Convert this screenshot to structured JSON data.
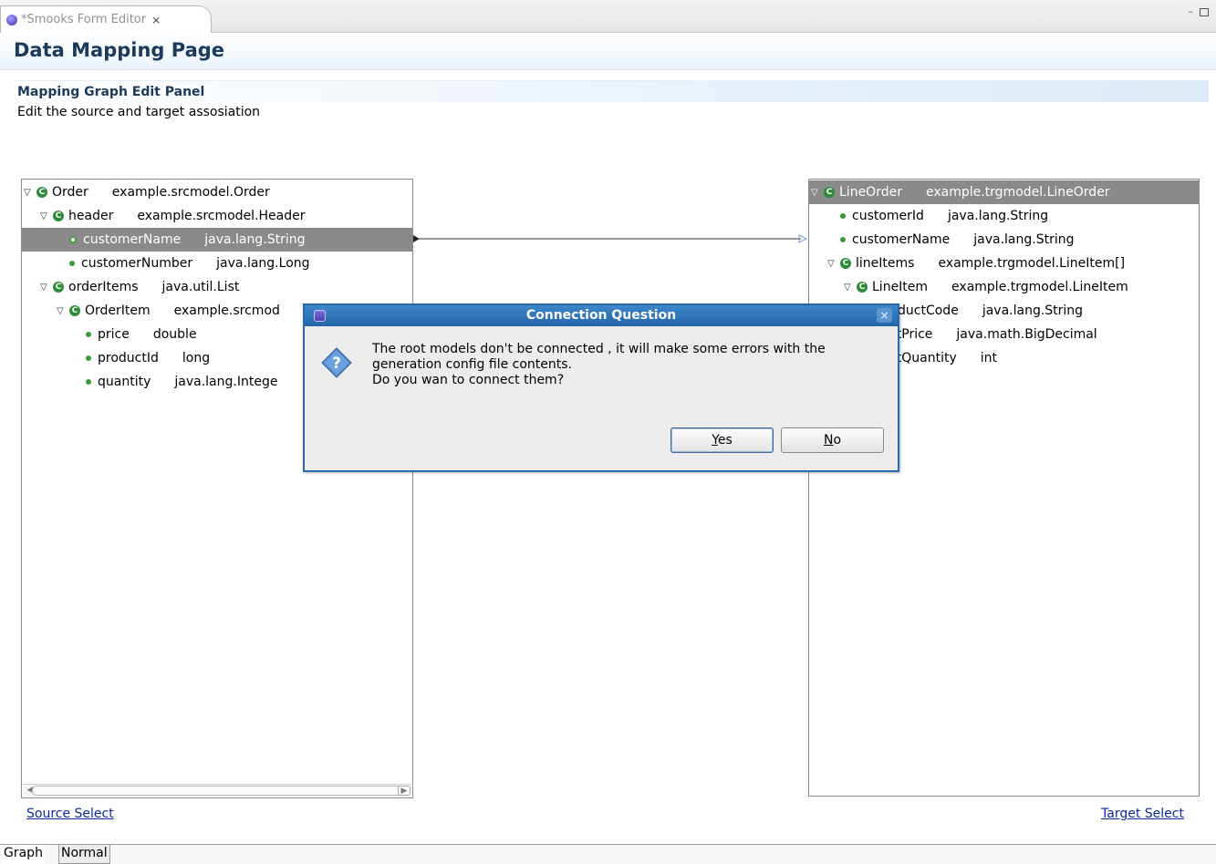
{
  "editor_tab": {
    "title": "*Smooks Form Editor",
    "close_glyph": "⨯"
  },
  "window_controls": {
    "minimize_glyph": "–"
  },
  "header": {
    "title": "Data Mapping Page"
  },
  "section": {
    "title": "Mapping Graph Edit Panel",
    "description": "Edit the source and target assosiation"
  },
  "source_tree": {
    "rows": [
      {
        "depth": 0,
        "kind": "class",
        "expanded": true,
        "name": "Order",
        "type": "example.srcmodel.Order"
      },
      {
        "depth": 1,
        "kind": "class",
        "expanded": true,
        "name": "header",
        "type": "example.srcmodel.Header"
      },
      {
        "depth": 2,
        "kind": "field",
        "name": "customerName",
        "type": "java.lang.String",
        "selected": true
      },
      {
        "depth": 2,
        "kind": "field",
        "name": "customerNumber",
        "type": "java.lang.Long"
      },
      {
        "depth": 1,
        "kind": "class",
        "expanded": true,
        "name": "orderItems",
        "type": "java.util.List"
      },
      {
        "depth": 2,
        "kind": "class",
        "expanded": true,
        "name": "OrderItem",
        "type": "example.srcmod"
      },
      {
        "depth": 3,
        "kind": "field",
        "name": "price",
        "type": "double"
      },
      {
        "depth": 3,
        "kind": "field",
        "name": "productId",
        "type": "long"
      },
      {
        "depth": 3,
        "kind": "field",
        "name": "quantity",
        "type": "java.lang.Intege"
      }
    ]
  },
  "target_tree": {
    "rows": [
      {
        "depth": 0,
        "kind": "class",
        "expanded": true,
        "name": "LineOrder",
        "type": "example.trgmodel.LineOrder",
        "selected": true
      },
      {
        "depth": 1,
        "kind": "field",
        "name": "customerId",
        "type": "java.lang.String"
      },
      {
        "depth": 1,
        "kind": "field",
        "name": "customerName",
        "type": "java.lang.String"
      },
      {
        "depth": 1,
        "kind": "class",
        "expanded": true,
        "name": "lineItems",
        "type": "example.trgmodel.LineItem[]"
      },
      {
        "depth": 2,
        "kind": "class",
        "expanded": true,
        "name": "LineItem",
        "type": "example.trgmodel.LineItem"
      },
      {
        "depth": 3,
        "kind": "field",
        "name": "roductCode",
        "type": "java.lang.String"
      },
      {
        "depth": 3,
        "kind": "field",
        "name": "nitPrice",
        "type": "java.math.BigDecimal"
      },
      {
        "depth": 3,
        "kind": "field",
        "name": "nitQuantity",
        "type": "int"
      }
    ]
  },
  "links": {
    "source_select": "Source Select",
    "target_select": "Target Select"
  },
  "page_tabs": {
    "graph": "Graph",
    "normal": "Normal"
  },
  "dialog": {
    "title": "Connection Question",
    "message_lines": [
      "The root models don't be connected , it will make some errors with the",
      "generation config file contents.",
      "Do you wan to connect them?"
    ],
    "yes_mnemonic": "Y",
    "yes_rest": "es",
    "no_mnemonic": "N",
    "no_rest": "o",
    "close_glyph": "×"
  },
  "colors": {
    "header_text": "#1b3a5c",
    "selection": "#8a8a8a",
    "dialog_titlebar": "#2366aa",
    "link": "#0a2a9c",
    "class_icon": "#2e8b3a"
  }
}
